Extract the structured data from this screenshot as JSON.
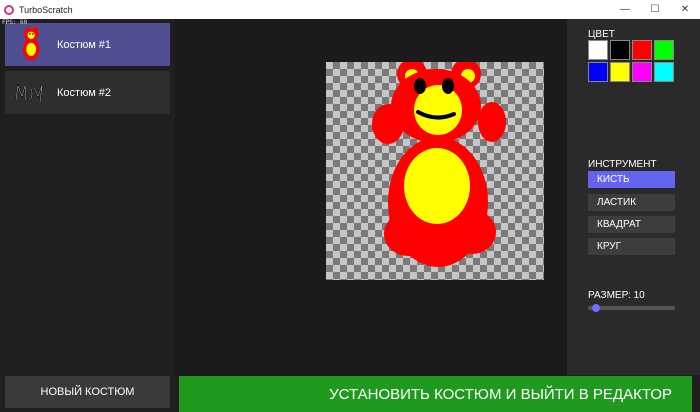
{
  "window": {
    "title": "TurboScratch",
    "minimize_glyph": "—",
    "maximize_glyph": "☐",
    "close_glyph": "✕"
  },
  "fps_text": "FPS: 60",
  "costumes": [
    {
      "label": "Костюм #1",
      "selected": true,
      "thumb": "bear-thumbnail"
    },
    {
      "label": "Костюм #2",
      "selected": false,
      "thumb": "scribble-thumbnail"
    }
  ],
  "new_costume_label": "НОВЫЙ КОСТЮМ",
  "apply_label": "УСТАНОВИТЬ КОСТЮМ И ВЫЙТИ В РЕДАКТОР",
  "color": {
    "label": "ЦВЕТ",
    "swatches": [
      "#ffffff",
      "#000000",
      "#ff0000",
      "#00ff00",
      "#0000ff",
      "#ffff00",
      "#ff00ff",
      "#00ffff"
    ]
  },
  "tool": {
    "label": "ИНСТРУМЕНТ",
    "items": [
      {
        "label": "КИСТЬ",
        "active": true
      },
      {
        "label": "ЛАСТИК",
        "active": false
      },
      {
        "label": "КВАДРАТ",
        "active": false
      },
      {
        "label": "КРУГ",
        "active": false
      }
    ]
  },
  "size": {
    "label": "РАЗМЕР: 10",
    "value": 10
  },
  "accent_colors": {
    "selected_costume": "#4f4f92",
    "active_tool": "#6464f0",
    "apply_button": "#1f9a1f",
    "bear_red": "#ff0000",
    "bear_yellow": "#ffff00"
  }
}
